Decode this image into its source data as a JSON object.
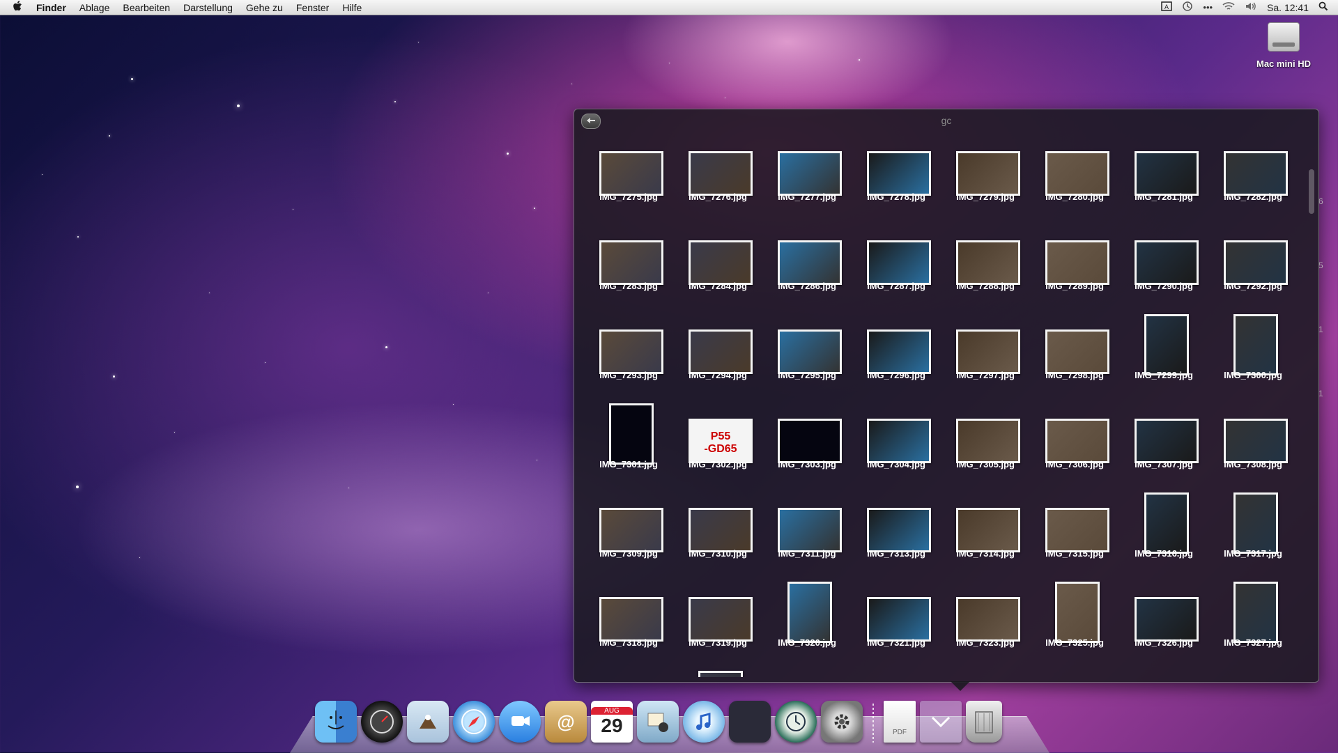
{
  "menubar": {
    "apple": "",
    "items": [
      "Finder",
      "Ablage",
      "Bearbeiten",
      "Darstellung",
      "Gehe zu",
      "Fenster",
      "Hilfe"
    ],
    "clock": "Sa. 12:41"
  },
  "desktop": {
    "hd_label": "Mac mini HD"
  },
  "stack": {
    "title": "gc",
    "back_icon": "back-arrow-icon",
    "files": [
      "IMG_7275.jpg",
      "IMG_7276.jpg",
      "IMG_7277.jpg",
      "IMG_7278.jpg",
      "IMG_7279.jpg",
      "IMG_7280.jpg",
      "IMG_7281.jpg",
      "IMG_7282.jpg",
      "IMG_7283.jpg",
      "IMG_7284.jpg",
      "IMG_7286.jpg",
      "IMG_7287.jpg",
      "IMG_7288.jpg",
      "IMG_7289.jpg",
      "IMG_7290.jpg",
      "IMG_7292.jpg",
      "IMG_7293.jpg",
      "IMG_7294.jpg",
      "IMG_7295.jpg",
      "IMG_7296.jpg",
      "IMG_7297.jpg",
      "IMG_7298.jpg",
      "IMG_7299.jpg",
      "IMG_7300.jpg",
      "IMG_7301.jpg",
      "IMG_7302.jpg",
      "IMG_7303.jpg",
      "IMG_7304.jpg",
      "IMG_7305.jpg",
      "IMG_7306.jpg",
      "IMG_7307.jpg",
      "IMG_7308.jpg",
      "IMG_7309.jpg",
      "IMG_7310.jpg",
      "IMG_7311.jpg",
      "IMG_7313.jpg",
      "IMG_7314.jpg",
      "IMG_7315.jpg",
      "IMG_7316.jpg",
      "IMG_7317.jpg",
      "IMG_7318.jpg",
      "IMG_7319.jpg",
      "IMG_7320.jpg",
      "IMG_7321.jpg",
      "IMG_7323.jpg",
      "IMG_7325.jpg",
      "IMG_7326.jpg",
      "IMG_7327.jpg"
    ],
    "thumb_text": {
      "mb_label_1": "P55",
      "mb_label_2": "-GD65"
    }
  },
  "dock": {
    "calendar_month": "AUG",
    "calendar_day": "29",
    "items": [
      "finder-icon",
      "dashboard-icon",
      "mail-stamp-icon",
      "safari-icon",
      "ichat-icon",
      "address-book-icon",
      "ical-icon",
      "iphoto-icon",
      "itunes-icon",
      "spaces-icon",
      "time-machine-icon",
      "system-preferences-icon",
      "pdf-document-icon",
      "downloads-stack-icon",
      "trash-icon"
    ]
  },
  "colors": {
    "accent_pink": "#c2409f",
    "window_bg": "#18181e",
    "thumb_border": "#f4f4f4"
  }
}
